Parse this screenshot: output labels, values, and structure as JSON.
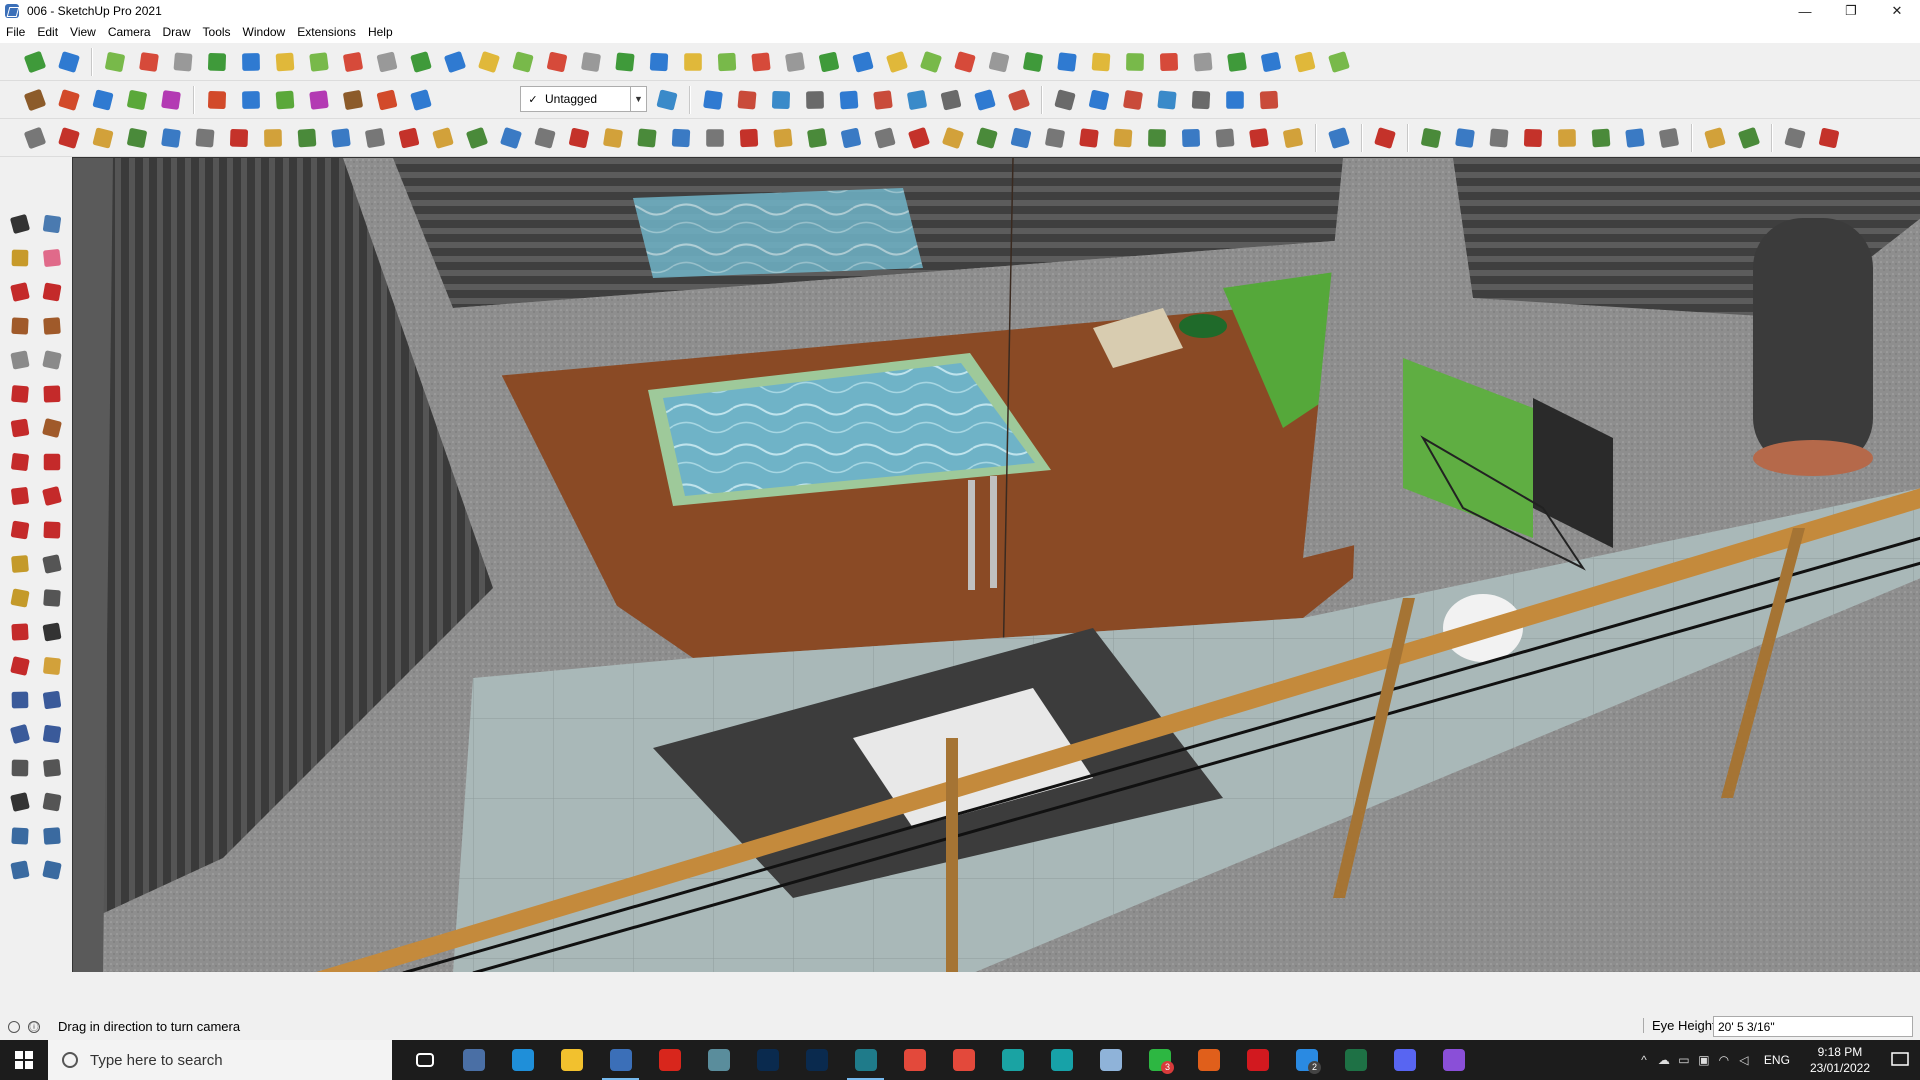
{
  "window": {
    "title": "006 - SketchUp Pro 2021",
    "minimize": "—",
    "restore": "❐",
    "close": "✕"
  },
  "menu": [
    "File",
    "Edit",
    "View",
    "Camera",
    "Draw",
    "Tools",
    "Window",
    "Extensions",
    "Help"
  ],
  "tag_selector": {
    "check": "✓",
    "value": "Untagged",
    "arrow": "▼"
  },
  "status": {
    "message": "Drag in direction to turn camera",
    "info_icon": "ⓘ",
    "measure_label": "Eye Height",
    "measure_value": "20' 5 3/16\""
  },
  "taskbar": {
    "search_placeholder": "Type here to search",
    "apps": [
      {
        "name": "task-view-icon",
        "color": "#ffffff"
      },
      {
        "name": "calculator-icon",
        "color": "#4a6fa5"
      },
      {
        "name": "edge-icon",
        "color": "#1f8fd9"
      },
      {
        "name": "file-explorer-icon",
        "color": "#f2c12e"
      },
      {
        "name": "sketchup-icon",
        "color": "#3b6fb8"
      },
      {
        "name": "acrobat-icon",
        "color": "#d8261c"
      },
      {
        "name": "snipping-icon",
        "color": "#5a8d9c"
      },
      {
        "name": "photoshop-icon",
        "color": "#0a2a4e"
      },
      {
        "name": "photoshop-2-icon",
        "color": "#0a2a4e"
      },
      {
        "name": "sketchup-layout-icon",
        "color": "#1f7b8a"
      },
      {
        "name": "chrome-icon",
        "color": "#e3493b"
      },
      {
        "name": "chrome-2-icon",
        "color": "#e3493b"
      },
      {
        "name": "style-builder-icon",
        "color": "#1aa3a3"
      },
      {
        "name": "sheets-icon",
        "color": "#17a2a8"
      },
      {
        "name": "notes-icon",
        "color": "#8fb3d9"
      },
      {
        "name": "whatsapp-icon",
        "color": "#2db742"
      },
      {
        "name": "g-app-icon",
        "color": "#e05f1b"
      },
      {
        "name": "opera-icon",
        "color": "#d2191f"
      },
      {
        "name": "vscode-icon",
        "color": "#2a8ae2"
      },
      {
        "name": "excel-icon",
        "color": "#1e7145"
      },
      {
        "name": "discord-icon",
        "color": "#5865f2"
      },
      {
        "name": "podcast-icon",
        "color": "#8a4fd8"
      }
    ],
    "whatsapp_badge": "3",
    "vscode_badge": "2",
    "language": "ENG",
    "time": "9:18 PM",
    "date": "23/01/2022"
  },
  "colors": {
    "floor": "#8a4a25",
    "pool": "#6fb3c7",
    "concrete": "#8c8c8c",
    "grass": "#55a83a",
    "rail": "#c48a3c"
  }
}
